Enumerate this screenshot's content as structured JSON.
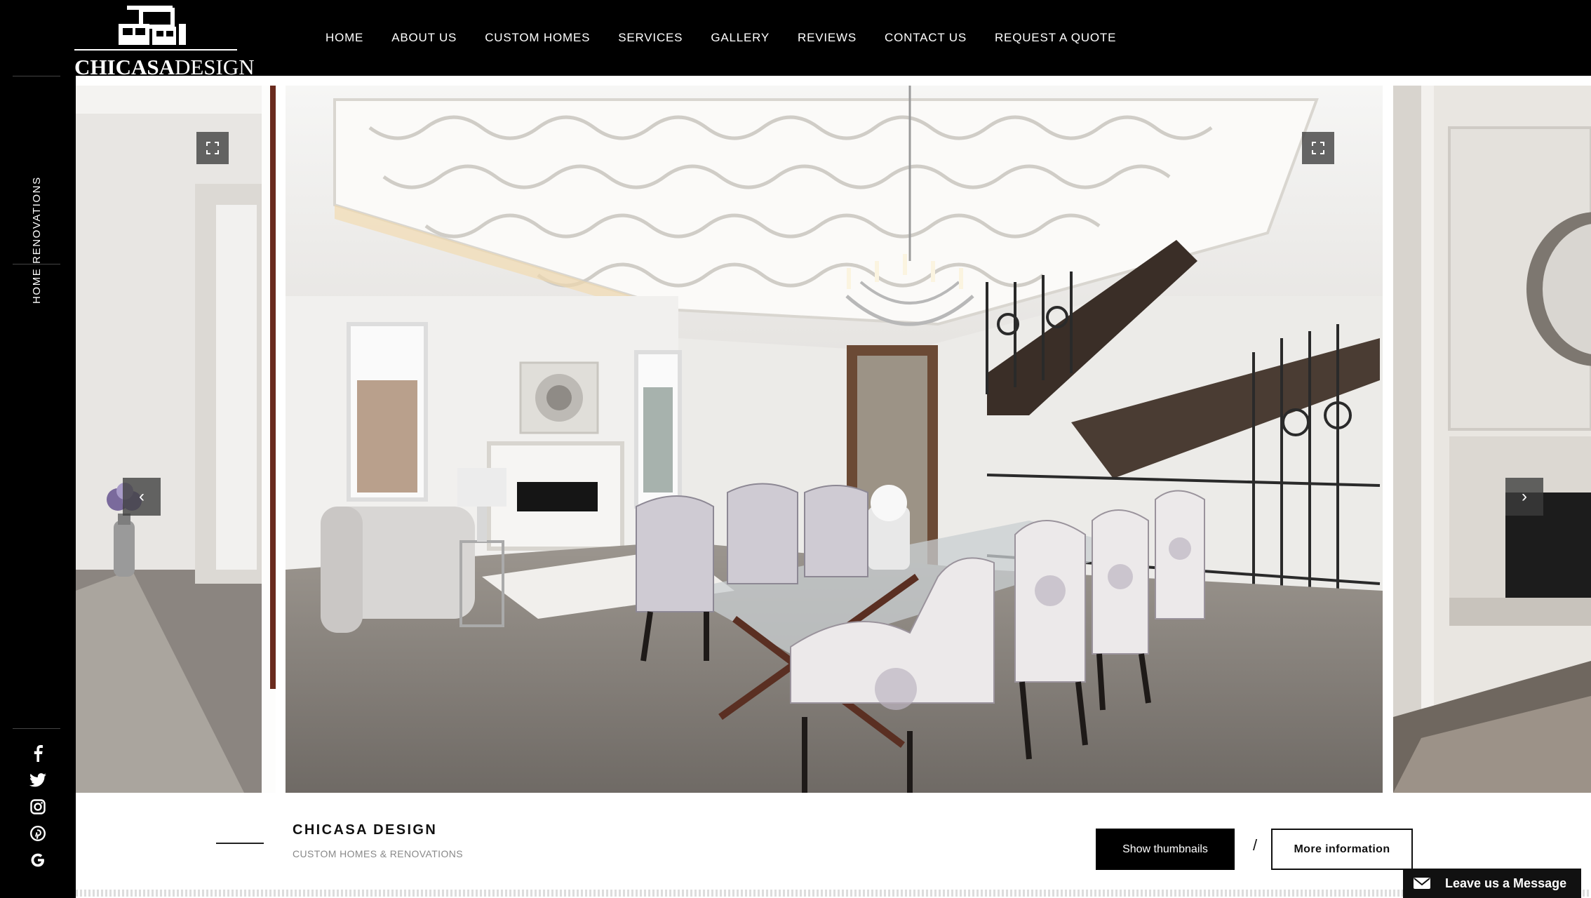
{
  "brand": {
    "logo_bold": "CHICASA",
    "logo_light": "DESIGN"
  },
  "nav": [
    {
      "label": "HOME"
    },
    {
      "label": "ABOUT US"
    },
    {
      "label": "CUSTOM HOMES"
    },
    {
      "label": "SERVICES"
    },
    {
      "label": "GALLERY"
    },
    {
      "label": "REVIEWS"
    },
    {
      "label": "CONTACT US"
    },
    {
      "label": "REQUEST A QUOTE"
    }
  ],
  "sidebar": {
    "category_label": "HOME RENOVATIONS",
    "social": [
      "facebook-icon",
      "twitter-icon",
      "instagram-icon",
      "pinterest-icon",
      "google-icon"
    ]
  },
  "gallery": {
    "slides": [
      "prev-slide-interior-hallway",
      "current-slide-dining-room-staircase",
      "next-slide-fireplace-mirror"
    ],
    "expand_icon": "expand-icon",
    "prev_icon": "chevron-left-icon",
    "next_icon": "chevron-right-icon",
    "prev_glyph": "‹",
    "next_glyph": "›"
  },
  "info": {
    "title": "CHICASA DESIGN",
    "subtitle": "CUSTOM HOMES & RENOVATIONS",
    "show_thumbnails": "Show thumbnails",
    "separator": "/",
    "more_information": "More information"
  },
  "chat": {
    "label": "Leave us a Message",
    "icon": "envelope-icon"
  },
  "colors": {
    "background": "#000000",
    "panel": "#ffffff",
    "text_dark": "#111111",
    "muted": "#888888"
  }
}
